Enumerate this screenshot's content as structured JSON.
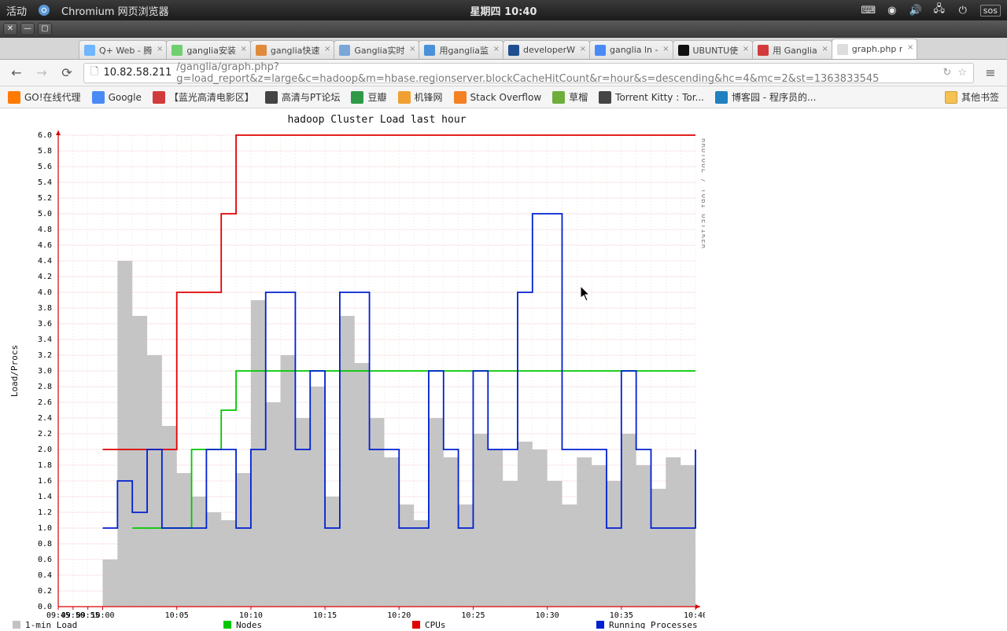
{
  "system": {
    "activities": "活动",
    "app_name": "Chromium 网页浏览器",
    "clock": "星期四 10:40",
    "tray": [
      "keyboard",
      "a11y",
      "volume",
      "network",
      "power",
      "sos"
    ],
    "sos_label": "sos"
  },
  "window_controls": [
    "close",
    "min",
    "max"
  ],
  "tabs": [
    {
      "label": "Q+ Web - 腾",
      "favicon": "#6fb5ff",
      "active": false
    },
    {
      "label": "ganglia安装",
      "favicon": "#6fcf6f",
      "active": false
    },
    {
      "label": "ganglia快速",
      "favicon": "#e08a3c",
      "active": false
    },
    {
      "label": "Ganglia实时",
      "favicon": "#7aa6d8",
      "active": false
    },
    {
      "label": "用ganglia监",
      "favicon": "#4a90d9",
      "active": false
    },
    {
      "label": "developerW",
      "favicon": "#1f4f8f",
      "active": false
    },
    {
      "label": "ganglia ln -",
      "favicon": "#4a8af4",
      "active": false
    },
    {
      "label": "UBUNTU使",
      "favicon": "#111111",
      "active": false
    },
    {
      "label": "用 Ganglia",
      "favicon": "#d23b3b",
      "active": false
    },
    {
      "label": "graph.php r",
      "favicon": "#dddddd",
      "active": true
    }
  ],
  "url": {
    "host": "10.82.58.211",
    "path": "/ganglia/graph.php?g=load_report&z=large&c=hadoop&m=hbase.regionserver.blockCacheHitCount&r=hour&s=descending&hc=4&mc=2&st=1363833545"
  },
  "bookmarks": [
    {
      "label": "GO!在线代理",
      "color": "#ff7a00"
    },
    {
      "label": "Google",
      "color": "#4a8af4"
    },
    {
      "label": "【蓝光高清电影区】",
      "color": "#d23b3b"
    },
    {
      "label": "高清与PT论坛",
      "color": "#444"
    },
    {
      "label": "豆瓣",
      "color": "#2e9a47"
    },
    {
      "label": "机锋网",
      "color": "#f0a030"
    },
    {
      "label": "Stack Overflow",
      "color": "#f48024"
    },
    {
      "label": "草榴",
      "color": "#6fae3a"
    },
    {
      "label": "Torrent Kitty : Tor...",
      "color": "#444"
    },
    {
      "label": "博客园 - 程序员的...",
      "color": "#2080c0"
    }
  ],
  "bookmarks_folder": "其他书签",
  "chart_data": {
    "type": "line",
    "title": "hadoop Cluster Load last hour",
    "xlabel": "",
    "ylabel": "Load/Procs",
    "ylim": [
      0.0,
      6.0
    ],
    "yticks": [
      0.0,
      0.2,
      0.4,
      0.6,
      0.8,
      1.0,
      1.2,
      1.4,
      1.6,
      1.8,
      2.0,
      2.2,
      2.4,
      2.6,
      2.8,
      3.0,
      3.2,
      3.4,
      3.6,
      3.8,
      4.0,
      4.2,
      4.4,
      4.6,
      4.8,
      5.0,
      5.2,
      5.4,
      5.6,
      5.8,
      6.0
    ],
    "xticks": [
      "09:45",
      "09:50",
      "09:55",
      "10:00",
      "10:05",
      "10:10",
      "10:15",
      "10:20",
      "10:25",
      "10:30",
      "10:35",
      "10:40"
    ],
    "watermark": "RRDTOOL / TOBI OETIKER",
    "legend": [
      {
        "name": "1-min Load",
        "color": "#bfbfbf",
        "type": "area"
      },
      {
        "name": "Nodes",
        "color": "#00c800",
        "type": "line"
      },
      {
        "name": "CPUs",
        "color": "#e00000",
        "type": "line"
      },
      {
        "name": "Running Processes",
        "color": "#0020d0",
        "type": "line"
      }
    ],
    "x": [
      "09:45",
      "09:50",
      "09:55",
      "10:00",
      "10:01",
      "10:02",
      "10:03",
      "10:04",
      "10:05",
      "10:06",
      "10:07",
      "10:08",
      "10:09",
      "10:10",
      "10:11",
      "10:12",
      "10:13",
      "10:14",
      "10:15",
      "10:16",
      "10:17",
      "10:18",
      "10:19",
      "10:20",
      "10:21",
      "10:22",
      "10:23",
      "10:24",
      "10:25",
      "10:26",
      "10:27",
      "10:28",
      "10:29",
      "10:30",
      "10:31",
      "10:32",
      "10:33",
      "10:34",
      "10:35",
      "10:36",
      "10:37",
      "10:38",
      "10:39",
      "10:40"
    ],
    "series": [
      {
        "name": "1-min Load",
        "values": [
          null,
          null,
          null,
          0.6,
          4.4,
          3.7,
          3.2,
          2.3,
          1.7,
          1.4,
          1.2,
          1.1,
          1.7,
          3.9,
          2.6,
          3.2,
          2.4,
          2.8,
          1.4,
          3.7,
          3.1,
          2.4,
          1.9,
          1.3,
          1.1,
          2.4,
          1.9,
          1.3,
          2.2,
          2.0,
          1.6,
          2.1,
          2.0,
          1.6,
          1.3,
          1.9,
          1.8,
          1.6,
          2.2,
          1.8,
          1.5,
          1.9,
          1.8,
          1.9
        ]
      },
      {
        "name": "Nodes",
        "values": [
          null,
          null,
          null,
          null,
          null,
          1,
          1,
          1,
          1,
          2,
          2,
          2.5,
          3,
          3,
          3,
          3,
          3,
          3,
          3,
          3,
          3,
          3,
          3,
          3,
          3,
          3,
          3,
          3,
          3,
          3,
          3,
          3,
          3,
          3,
          3,
          3,
          3,
          3,
          3,
          3,
          3,
          3,
          3,
          3
        ]
      },
      {
        "name": "CPUs",
        "values": [
          null,
          null,
          null,
          2,
          2,
          2,
          2,
          2,
          4,
          4,
          4,
          5,
          6,
          6,
          6,
          6,
          6,
          6,
          6,
          6,
          6,
          6,
          6,
          6,
          6,
          6,
          6,
          6,
          6,
          6,
          6,
          6,
          6,
          6,
          6,
          6,
          6,
          6,
          6,
          6,
          6,
          6,
          6,
          6
        ]
      },
      {
        "name": "Running Processes",
        "values": [
          null,
          null,
          null,
          1,
          1.6,
          1.2,
          2,
          1,
          1,
          1,
          2,
          2,
          1,
          2,
          4,
          4,
          2,
          3,
          1,
          4,
          4,
          2,
          2,
          1,
          1,
          3,
          2,
          1,
          3,
          2,
          2,
          4,
          5,
          5,
          2,
          2,
          2,
          1,
          3,
          2,
          1,
          1,
          1,
          2
        ]
      }
    ]
  }
}
